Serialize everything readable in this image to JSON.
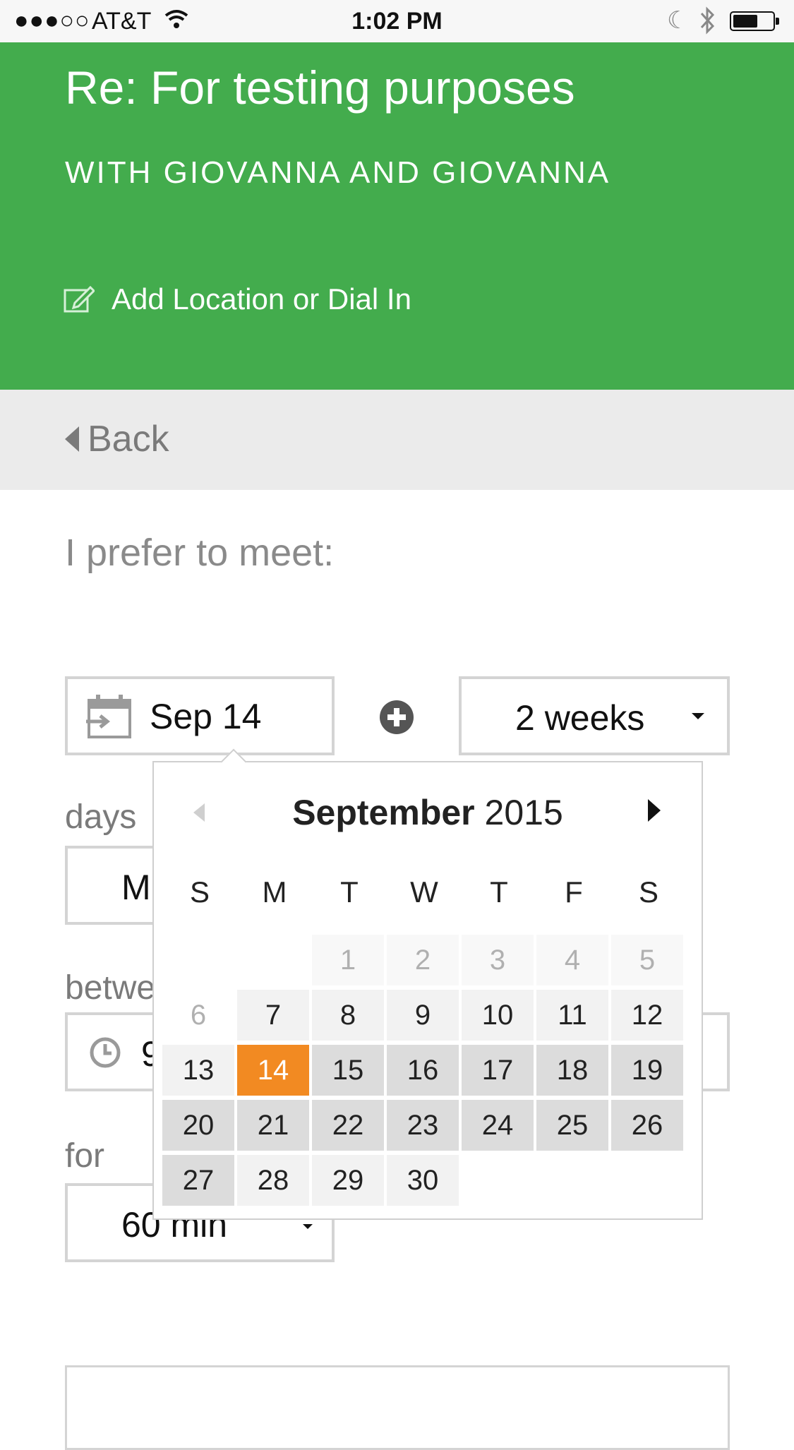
{
  "status_bar": {
    "signal": "●●●○○",
    "carrier": "AT&T",
    "time": "1:02 PM",
    "icons": [
      "wifi-icon",
      "moon-icon",
      "bluetooth-icon",
      "battery-icon"
    ]
  },
  "header": {
    "title": "Re: For testing purposes",
    "subtitle": "WITH GIOVANNA AND GIOVANNA",
    "location_link": "Add Location or Dial In",
    "background_color": "#43ac4d"
  },
  "nav": {
    "back_label": "Back"
  },
  "form": {
    "prompt": "I prefer to meet:",
    "start_date": "Sep 14",
    "duration_range": "2 weeks",
    "days_label": "days",
    "days_value": "M",
    "between_label": "betwe",
    "between_value": "9",
    "for_label": "for",
    "for_value": "60 min"
  },
  "datepicker": {
    "month": "September",
    "year": "2015",
    "weekdays": [
      "S",
      "M",
      "T",
      "W",
      "T",
      "F",
      "S"
    ],
    "selected_day": "14",
    "selected_color": "#f28a22",
    "weeks": [
      [
        "",
        "",
        "1",
        "2",
        "3",
        "4",
        "5"
      ],
      [
        "6",
        "7",
        "8",
        "9",
        "10",
        "11",
        "12"
      ],
      [
        "13",
        "14",
        "15",
        "16",
        "17",
        "18",
        "19"
      ],
      [
        "20",
        "21",
        "22",
        "23",
        "24",
        "25",
        "26"
      ],
      [
        "27",
        "28",
        "29",
        "30",
        "",
        "",
        ""
      ]
    ]
  }
}
